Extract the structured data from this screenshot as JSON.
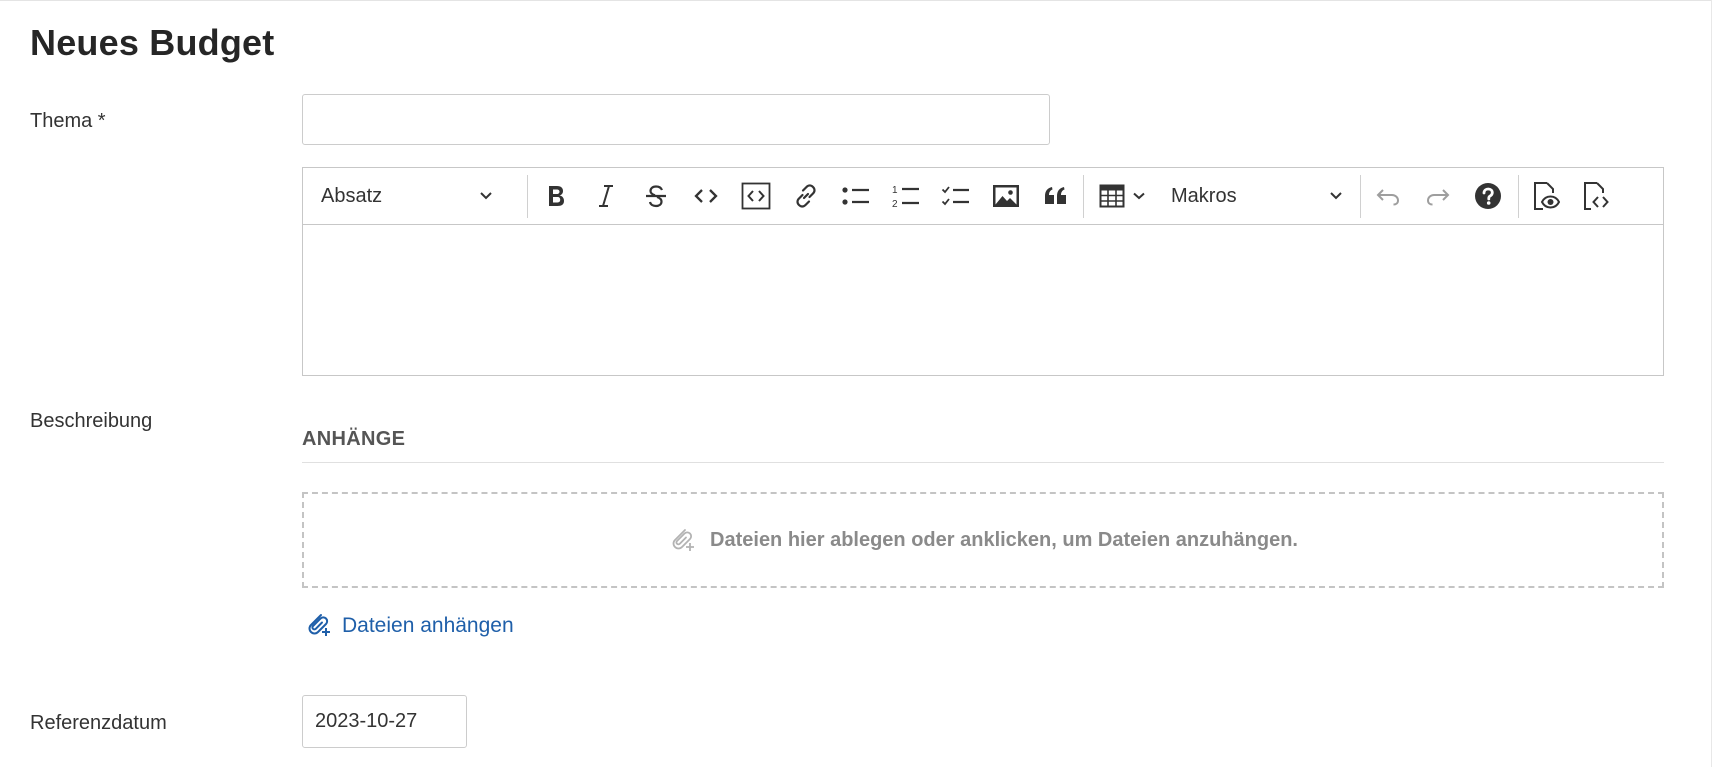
{
  "page": {
    "title": "Neues Budget"
  },
  "form": {
    "subject": {
      "label": "Thema *",
      "value": ""
    },
    "description": {
      "label": "Beschreibung"
    },
    "reference_date": {
      "label": "Referenzdatum",
      "value": "2023-10-27"
    }
  },
  "editor": {
    "paragraph_dropdown": "Absatz",
    "macros_dropdown": "Makros",
    "tools": [
      "bold-icon",
      "italic-icon",
      "strikethrough-icon",
      "code-icon",
      "code-block-icon",
      "link-icon",
      "bulleted-list-icon",
      "numbered-list-icon",
      "todo-list-icon",
      "image-icon",
      "blockquote-icon",
      "table-icon",
      "undo-icon",
      "redo-icon",
      "help-icon",
      "preview-icon",
      "source-icon"
    ]
  },
  "attachments": {
    "heading": "ANHÄNGE",
    "dropzone_text": "Dateien hier ablegen oder anklicken, um Dateien anzuhängen.",
    "attach_link": "Dateien anhängen"
  },
  "colors": {
    "link": "#1f5fa9",
    "muted": "#8a8a8a"
  }
}
